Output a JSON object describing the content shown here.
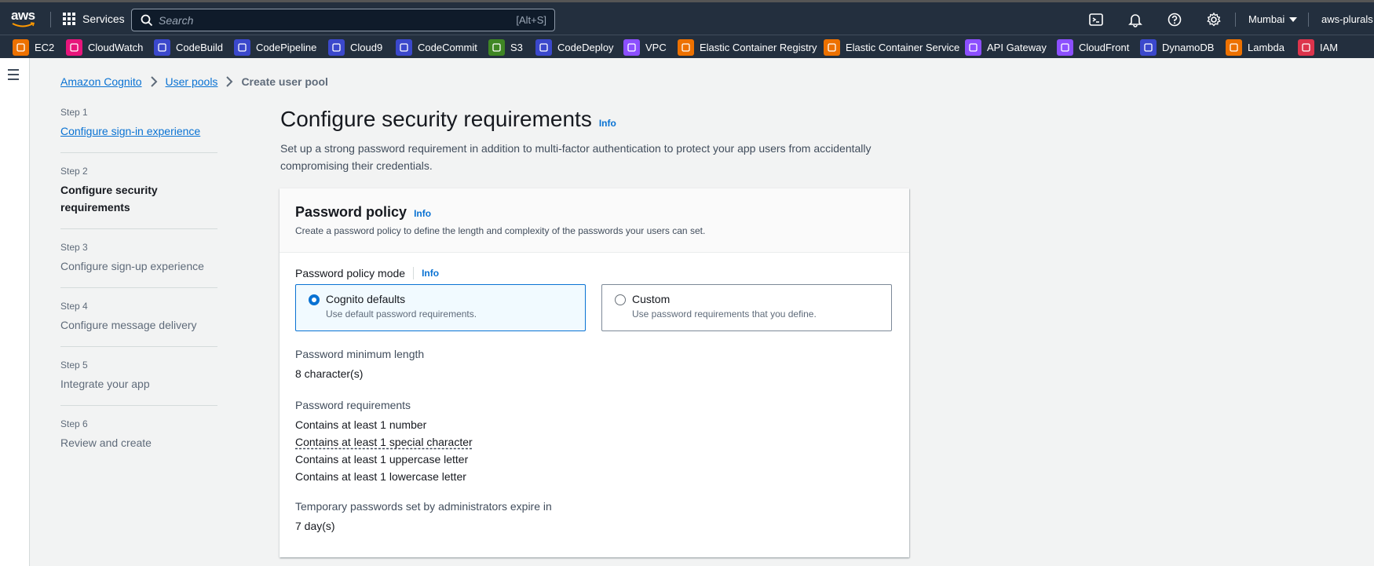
{
  "topnav": {
    "logo_text": "aws",
    "services_label": "Services",
    "search_placeholder": "Search",
    "search_shortcut": "[Alt+S]",
    "region": "Mumbai",
    "account": "aws-plurals"
  },
  "favorites": [
    {
      "label": "EC2",
      "color": "#ed7100"
    },
    {
      "label": "CloudWatch",
      "color": "#e7157b"
    },
    {
      "label": "CodeBuild",
      "color": "#3b48cc"
    },
    {
      "label": "CodePipeline",
      "color": "#3b48cc"
    },
    {
      "label": "Cloud9",
      "color": "#3b48cc"
    },
    {
      "label": "CodeCommit",
      "color": "#3b48cc"
    },
    {
      "label": "S3",
      "color": "#3f8624"
    },
    {
      "label": "CodeDeploy",
      "color": "#3b48cc"
    },
    {
      "label": "VPC",
      "color": "#8c4fff"
    },
    {
      "label": "Elastic Container Registry",
      "color": "#ed7100"
    },
    {
      "label": "Elastic Container Service",
      "color": "#ed7100"
    },
    {
      "label": "API Gateway",
      "color": "#8c4fff"
    },
    {
      "label": "CloudFront",
      "color": "#8c4fff"
    },
    {
      "label": "DynamoDB",
      "color": "#3b48cc"
    },
    {
      "label": "Lambda",
      "color": "#ed7100"
    },
    {
      "label": "IAM",
      "color": "#dd344c"
    }
  ],
  "breadcrumb": {
    "items": [
      "Amazon Cognito",
      "User pools"
    ],
    "current": "Create user pool"
  },
  "steps": [
    {
      "num": "Step 1",
      "title": "Configure sign-in experience"
    },
    {
      "num": "Step 2",
      "title": "Configure security requirements"
    },
    {
      "num": "Step 3",
      "title": "Configure sign-up experience"
    },
    {
      "num": "Step 4",
      "title": "Configure message delivery"
    },
    {
      "num": "Step 5",
      "title": "Integrate your app"
    },
    {
      "num": "Step 6",
      "title": "Review and create"
    }
  ],
  "page": {
    "title": "Configure security requirements",
    "info": "Info",
    "description": "Set up a strong password requirement in addition to multi-factor authentication to protect your app users from accidentally compromising their credentials."
  },
  "password_policy": {
    "title": "Password policy",
    "info": "Info",
    "description": "Create a password policy to define the length and complexity of the passwords your users can set.",
    "mode_label": "Password policy mode",
    "mode_info": "Info",
    "options": [
      {
        "label": "Cognito defaults",
        "desc": "Use default password requirements.",
        "selected": true
      },
      {
        "label": "Custom",
        "desc": "Use password requirements that you define.",
        "selected": false
      }
    ],
    "min_length_label": "Password minimum length",
    "min_length_value": "8 character(s)",
    "requirements_label": "Password requirements",
    "requirements": [
      "Contains at least 1 number",
      "Contains at least 1 special character",
      "Contains at least 1 uppercase letter",
      "Contains at least 1 lowercase letter"
    ],
    "temp_label": "Temporary passwords set by administrators expire in",
    "temp_value": "7 day(s)"
  }
}
